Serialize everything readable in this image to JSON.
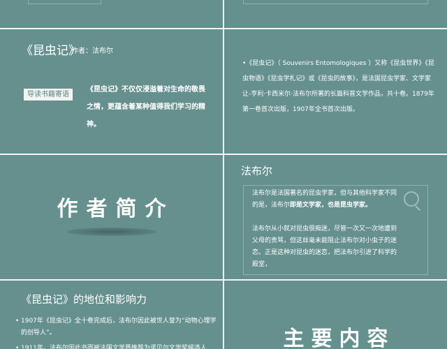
{
  "slide_intro": {
    "book_title": "《昆虫记》",
    "author_label": "作者：法布尔",
    "badge": "导读书籍寄语",
    "quote": "《昆虫记》不仅仅浸溢着对生命的敬畏之情，更蕴含着某种值得我们学习的精神。"
  },
  "slide_book": {
    "text": "•《昆虫记》（ Souvenirs Entomologiques ）又称《昆虫世界》《昆虫物语》《昆虫学札记》或《昆虫的故事》，是法国昆虫学家、文学家让-亨利·卡西米尔·法布尔所著的长篇科普文学作品，共十卷。1879年第一卷首次出版，1907年全书首次出版。"
  },
  "slide_section_author": {
    "title": "作者简介"
  },
  "slide_fabre": {
    "title": "法布尔",
    "para1_prefix": "法布尔是法国著名的昆虫学家，但与其他科学家不同的是，法布尔",
    "para1_bold": "即是文学家，也是昆虫学家。",
    "para2": "法布尔从小就对昆虫很痴迷，尽管一次又一次地遭到父母的责骂，但这丝毫未能阻止法布尔对小虫子的迷恋。正是这种对昆虫的迷恋，把法布尔引进了科学的殿堂，"
  },
  "slide_status": {
    "title": "《昆虫记》的地位和影响力",
    "items": [
      "1907年《昆虫记》全十卷完成后，法布尔因此被世人誉为“动物心理学的创导人”。",
      "1911年，法布尔因此书而被法国文学界推荐为诺贝尔文学奖候选人"
    ]
  },
  "slide_section_content": {
    "title": "主要内容"
  },
  "icons": {
    "search": "search-icon"
  }
}
